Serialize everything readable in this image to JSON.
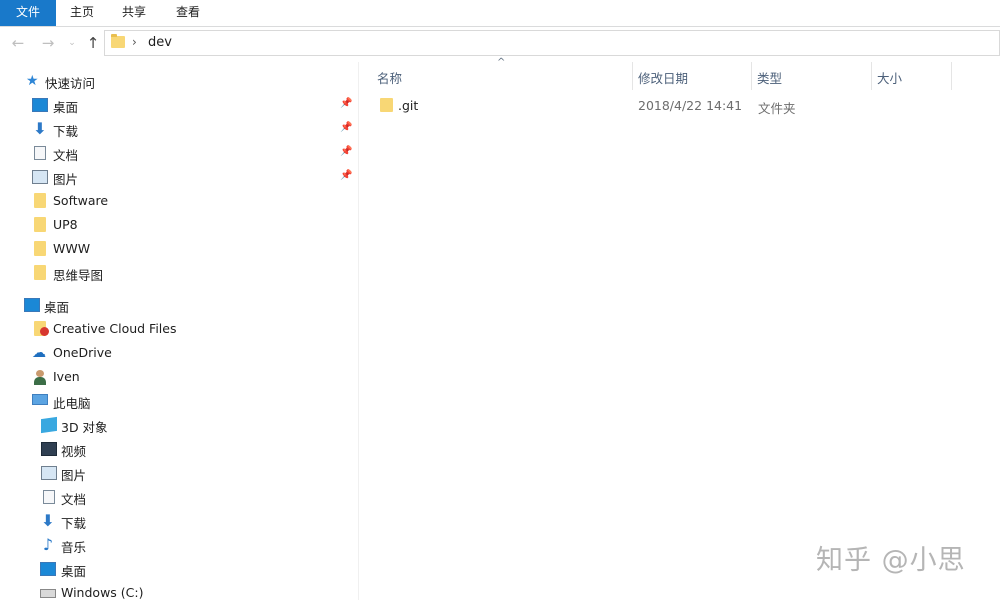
{
  "ribbon": {
    "tabs": [
      "文件",
      "主页",
      "共享",
      "查看"
    ]
  },
  "address": {
    "path": [
      "dev"
    ],
    "separator": "›",
    "nav": {
      "back": "←",
      "forward": "→",
      "dropdown": "⌄",
      "up": "↑"
    }
  },
  "navpane": {
    "quick_access_label": "快速访问",
    "quick_access_items": [
      {
        "label": "桌面",
        "icon": "desktop-icon",
        "pinned": true
      },
      {
        "label": "下载",
        "icon": "download-icon",
        "pinned": true
      },
      {
        "label": "文档",
        "icon": "document-icon",
        "pinned": true
      },
      {
        "label": "图片",
        "icon": "pictures-icon",
        "pinned": true
      },
      {
        "label": "Software",
        "icon": "folder-icon",
        "pinned": false
      },
      {
        "label": "UP8",
        "icon": "folder-icon",
        "pinned": false
      },
      {
        "label": "WWW",
        "icon": "folder-icon",
        "pinned": false
      },
      {
        "label": "思维导图",
        "icon": "folder-icon",
        "pinned": false
      }
    ],
    "desktop_label": "桌面",
    "desktop_children": [
      {
        "label": "Creative Cloud Files",
        "icon": "creative-cloud-folder-icon"
      },
      {
        "label": "OneDrive",
        "icon": "onedrive-icon"
      },
      {
        "label": "Iven",
        "icon": "user-icon"
      },
      {
        "label": "此电脑",
        "icon": "this-pc-icon"
      }
    ],
    "pc_children": [
      {
        "label": "3D 对象",
        "icon": "3d-objects-icon"
      },
      {
        "label": "视频",
        "icon": "video-icon"
      },
      {
        "label": "图片",
        "icon": "pictures-icon"
      },
      {
        "label": "文档",
        "icon": "document-icon"
      },
      {
        "label": "下载",
        "icon": "download-icon"
      },
      {
        "label": "音乐",
        "icon": "music-icon"
      },
      {
        "label": "桌面",
        "icon": "desktop-icon"
      },
      {
        "label": "Windows (C:)",
        "icon": "drive-icon"
      }
    ]
  },
  "filelist": {
    "columns": [
      "名称",
      "修改日期",
      "类型",
      "大小"
    ],
    "rows": [
      {
        "name": ".git",
        "modified": "2018/4/22 14:41",
        "type": "文件夹",
        "size": ""
      }
    ]
  },
  "watermark": "知乎 @小思",
  "colors": {
    "accent": "#1979ca",
    "folder": "#f8d775",
    "header_text": "#4c607a"
  }
}
